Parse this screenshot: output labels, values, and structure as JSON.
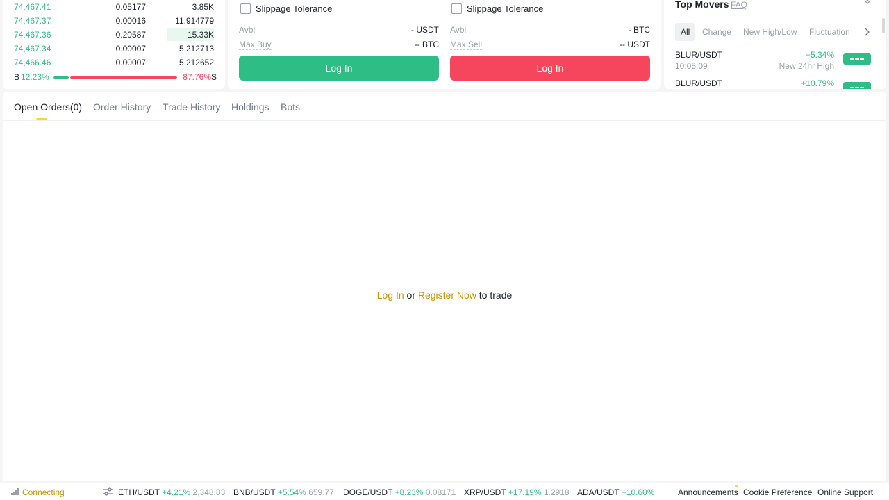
{
  "orderbook": {
    "rows": [
      {
        "price": "74,467.41",
        "amount": "0.05177",
        "total": "3.85K",
        "depth": 0.0
      },
      {
        "price": "74,467.37",
        "amount": "0.00016",
        "total": "11.914779",
        "depth": 0.0
      },
      {
        "price": "74,467.36",
        "amount": "0.20587",
        "total": "15.33K",
        "depth": 0.23
      },
      {
        "price": "74,467.34",
        "amount": "0.00007",
        "total": "5.212713",
        "depth": 0.0
      },
      {
        "price": "74,466.46",
        "amount": "0.00007",
        "total": "5.212652",
        "depth": 0.0
      }
    ],
    "buy_label": "B",
    "buy_pct": "12.23%",
    "sell_pct": "87.76%",
    "sell_label": "S"
  },
  "tradeform": {
    "buy": {
      "slippage_label": "Slippage Tolerance",
      "avbl_label": "Avbl",
      "avbl_value": "- USDT",
      "max_label": "Max Buy",
      "max_value": "-- BTC",
      "button_label": "Log In"
    },
    "sell": {
      "slippage_label": "Slippage Tolerance",
      "avbl_label": "Avbl",
      "avbl_value": "- BTC",
      "max_label": "Max Sell",
      "max_value": "-- USDT",
      "button_label": "Log In"
    }
  },
  "top_movers": {
    "title": "Top Movers",
    "faq": "FAQ",
    "tabs": [
      "All",
      "Change",
      "New High/Low",
      "Fluctuation"
    ],
    "items": [
      {
        "pair": "BLUR/USDT",
        "time": "10:05:09",
        "change": "+5.34%",
        "desc": "New 24hr High"
      },
      {
        "pair": "BLUR/USDT",
        "time": "",
        "change": "+10.79%",
        "desc": ""
      }
    ]
  },
  "orders": {
    "tabs": [
      "Open Orders(0)",
      "Order History",
      "Trade History",
      "Holdings",
      "Bots"
    ],
    "login_link": "Log In",
    "or_text": "or",
    "register_link": "Register Now",
    "to_trade": "to trade"
  },
  "statusbar": {
    "connection": "Connecting",
    "tickers": [
      {
        "symbol": "ETH/USDT",
        "change": "+4.21%",
        "price": "2,348.83"
      },
      {
        "symbol": "BNB/USDT",
        "change": "+5.54%",
        "price": "659.77"
      },
      {
        "symbol": "DOGE/USDT",
        "change": "+8.23%",
        "price": "0.08171"
      },
      {
        "symbol": "XRP/USDT",
        "change": "+17.19%",
        "price": "1.2918"
      },
      {
        "symbol": "ADA/USDT",
        "change": "+10.60%",
        "price": ""
      }
    ],
    "links": [
      "Announcements",
      "Cookie Preference",
      "Online Support"
    ]
  },
  "colors": {
    "buy": "#2ebd85",
    "sell": "#f6465d",
    "accent": "#fcd535",
    "link": "#c99400"
  }
}
